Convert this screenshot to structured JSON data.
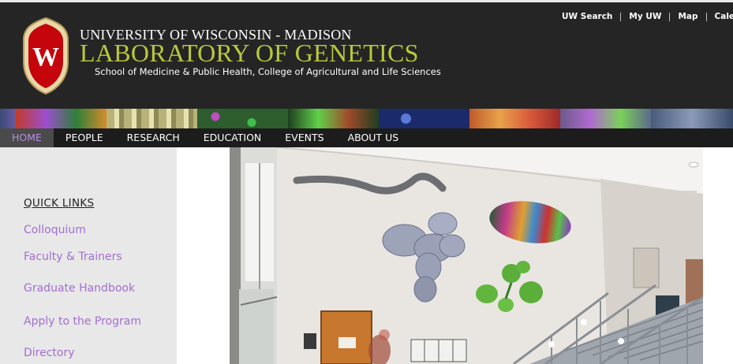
{
  "header": {
    "university": "UNIVERSITY OF WISCONSIN - MADISON",
    "lab": "LABORATORY OF GENETICS",
    "school": "School of Medicine & Public Health, College of Agricultural and Life Sciences",
    "crest_letter": "W"
  },
  "utility_links": [
    "UW Search",
    "My UW",
    "Map",
    "Calen"
  ],
  "nav": {
    "items": [
      "HOME",
      "PEOPLE",
      "RESEARCH",
      "EDUCATION",
      "EVENTS",
      "ABOUT US"
    ],
    "active": "HOME"
  },
  "sidebar": {
    "heading": "QUICK LINKS",
    "links": [
      "Colloquium",
      "Faculty & Trainers",
      "Graduate Handbook",
      "Apply to the Program",
      "Directory"
    ]
  },
  "colors": {
    "header_bg": "#252525",
    "lab_title": "#b9c83c",
    "link_purple": "#a36fd0",
    "nav_active_text": "#b88ee0",
    "sidebar_bg": "#e8e8e8"
  },
  "icons": [
    "uw-crest-icon"
  ]
}
